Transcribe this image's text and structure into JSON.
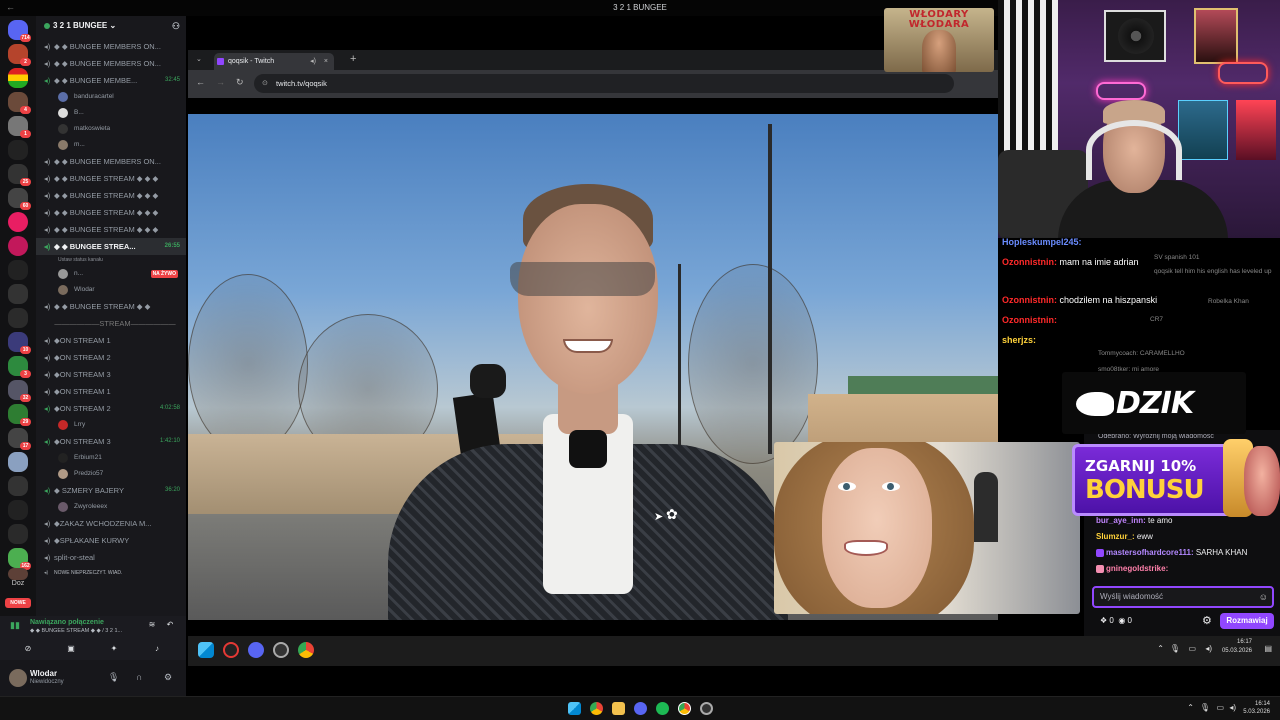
{
  "window": {
    "title": "3 2 1 BUNGEE"
  },
  "rail": {
    "badges": [
      "714",
      "2",
      "",
      "4",
      "1",
      "",
      "25",
      "60",
      "",
      "",
      "",
      "",
      "",
      "10",
      "3",
      "32",
      "29",
      "17",
      "",
      "",
      "",
      "",
      "162",
      "16"
    ],
    "doz_label": "Doz",
    "new_label": "NOWE"
  },
  "server": {
    "name": "3 2 1 BUNGEE"
  },
  "channels": {
    "c1": "◆ ◆ BUNGEE MEMBERS ON...",
    "c2": "◆ ◆ BUNGEE MEMBERS ON...",
    "c3": "◆ ◆ BUNGEE MEMBE...",
    "c3_time": "32:45",
    "c3_users": [
      "banduracartel",
      "B...",
      "matkoswieta",
      "m..."
    ],
    "c4": "◆ ◆ BUNGEE MEMBERS ON...",
    "c5": "◆ ◆ BUNGEE STREAM ◆ ◆ ◆",
    "c6": "◆ ◆ BUNGEE STREAM ◆ ◆ ◆",
    "c7": "◆ ◆ BUNGEE STREAM ◆ ◆ ◆",
    "c8": "◆ ◆ BUNGEE STREAM ◆ ◆ ◆",
    "c9": "◆ ◆ BUNGEE STREA...",
    "c9_time": "26:55",
    "c9_status": "Ustaw status kanału",
    "c9_users": [
      "n...",
      "Wlodar"
    ],
    "live_label": "NA ŻYWO",
    "c10": "◆ ◆ BUNGEE STREAM ◆ ◆",
    "sep": "STREAM",
    "s1": "◆ON STREAM 1",
    "s2": "◆ON STREAM 2",
    "s3": "◆ON STREAM 3",
    "s4": "◆ON STREAM 1",
    "s5": "◆ON STREAM 2",
    "s5_time": "4:02:58",
    "s5_user": "Lrry",
    "s6": "◆ON STREAM 3",
    "s6_time": "1:42:10",
    "s6_users": [
      "Erbium21",
      "Predzio57"
    ],
    "s7": "◆ SZMERY BAJERY",
    "s7_time": "36:20",
    "s7_user": "Zwyroleeex",
    "s8": "◆ZAKAZ WCHODZENIA M...",
    "s9": "◆SPŁAKANE KURWY",
    "s10": "split-or-steal",
    "s11": "NOWE NIEPRZECZYT. WIAD."
  },
  "voice": {
    "status": "Nawiązano połączenie",
    "channel": "◆ ◆ BUNGEE STREAM ◆ ◆ / 3 2 1..."
  },
  "user": {
    "name": "Wlodar",
    "status": "Niewidoczny"
  },
  "browser": {
    "tab_title": "qoqsik - Twitch",
    "url": "twitch.tv/qoqsik"
  },
  "sponsor": {
    "text": "WŁODARY WŁODARA"
  },
  "stream_chat": {
    "m1_name": "Hopleskumpel245:",
    "m2_name": "Ozonnistnin:",
    "m2_text": "mam na imie adrian",
    "m3_name": "Ozonnistnin:",
    "m3_text": "chodzilem na hiszpanski",
    "m4_name": "Ozonnistnin:",
    "m5_name": "sherjzs:",
    "faint": [
      "SV spanish 101",
      "qoqsik tell him his english has leveled up",
      "Robelka Khan",
      "CR7",
      "Tommycoach: CARAMELLHO",
      "smo08tker: mi amore"
    ]
  },
  "ads": {
    "dzik": "DZIK",
    "bonus_l1": "ZGARNIJ 10%",
    "bonus_l2": "BONUSU"
  },
  "twitch_chat": {
    "redeem": "Odebrano: Wyróżnij moją wiadomość",
    "m1_name": "bur_aye_inn:",
    "m1_text": " te amo",
    "m2_name": "Slumzur_:",
    "m2_text": " eww",
    "m3_name": "mastersofhardcore111:",
    "m3_text": " SARHA KHAN",
    "m4_name": "gninegoldstrike:",
    "m4_text": "",
    "input_placeholder": "Wyślij wiadomość",
    "points": "0",
    "bits": "0",
    "send_label": "Rozmawiaj"
  },
  "inner_taskbar": {
    "time": "16:17",
    "date": "05.03.2026"
  },
  "taskbar": {
    "time": "16:14",
    "date": "5.03.2026"
  },
  "colors": {
    "discord_green": "#3ba55d",
    "live_red": "#ed4245",
    "twitch_purple": "#9147ff"
  }
}
